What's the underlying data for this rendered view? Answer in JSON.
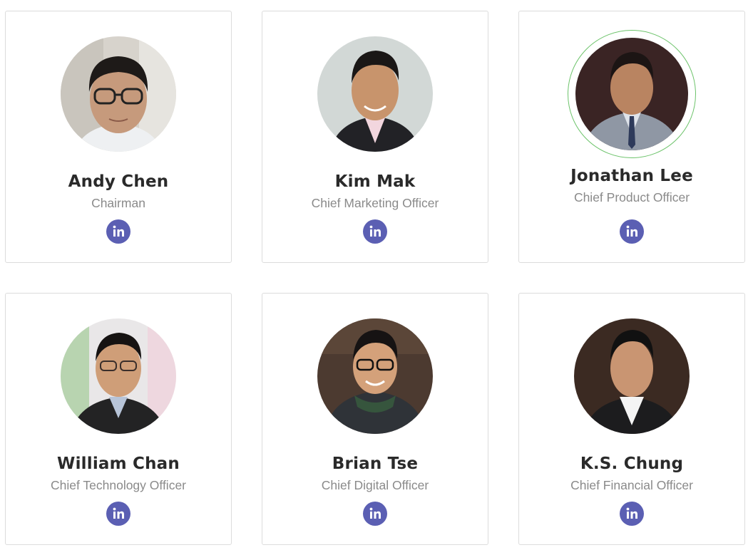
{
  "team": {
    "members": [
      {
        "name": "Andy Chen",
        "role": "Chairman",
        "link_icon": "linkedin-icon"
      },
      {
        "name": "Kim Mak",
        "role": "Chief Marketing Officer",
        "link_icon": "linkedin-icon"
      },
      {
        "name": "Jonathan Lee",
        "role": "Chief Product Officer",
        "link_icon": "linkedin-icon"
      },
      {
        "name": "William Chan",
        "role": "Chief Technology Officer",
        "link_icon": "linkedin-icon"
      },
      {
        "name": "Brian Tse",
        "role": "Chief Digital Officer",
        "link_icon": "linkedin-icon"
      },
      {
        "name": "K.S. Chung",
        "role": "Chief Financial Officer",
        "link_icon": "linkedin-icon"
      }
    ]
  },
  "colors": {
    "card_border": "#dcdcdc",
    "name_text": "#2a2a2a",
    "role_text": "#8a8a8a",
    "linkedin_button": "#5b5fb3",
    "hover_ring": "#6cc36a"
  }
}
